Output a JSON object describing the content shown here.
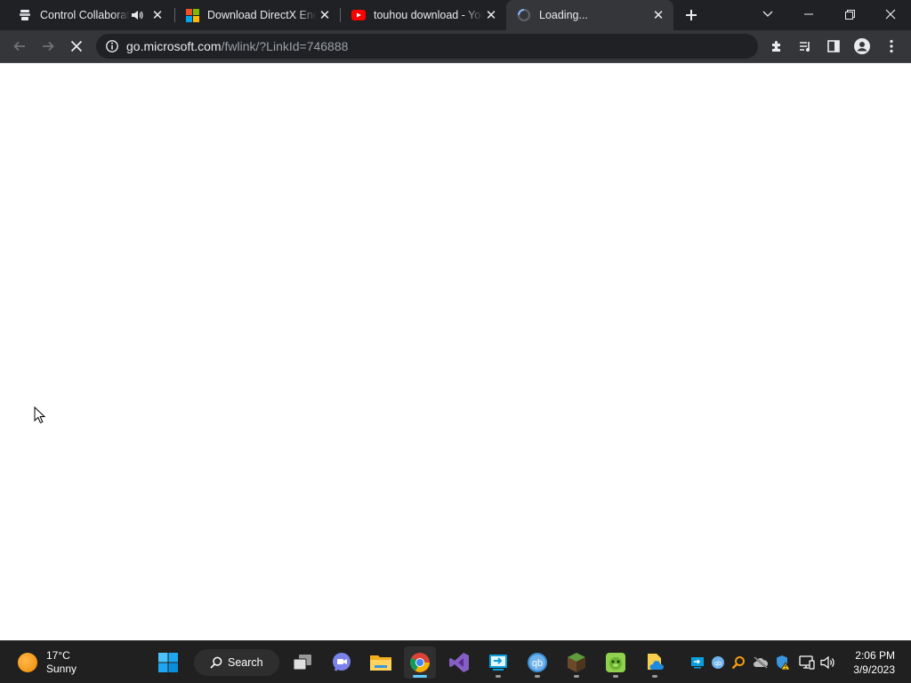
{
  "browser": {
    "tabs": [
      {
        "title": "Control Collaboration",
        "favicon": "parsec-icon",
        "audio": true
      },
      {
        "title": "Download DirectX End-User Runtime",
        "favicon": "microsoft-icon"
      },
      {
        "title": "touhou download - YouTube",
        "favicon": "youtube-icon"
      },
      {
        "title": "Loading...",
        "favicon": "loading-spinner-icon",
        "active": true
      }
    ],
    "new_tab_label": "+",
    "omnibox": {
      "host": "go.microsoft.com",
      "path": "/fwlink/?LinkId=746888"
    }
  },
  "taskbar": {
    "weather": {
      "temp": "17°C",
      "condition": "Sunny"
    },
    "search_label": "Search",
    "apps": [
      "start-icon",
      "search-icon",
      "task-view-icon",
      "chat-icon",
      "file-explorer-icon",
      "chrome-icon",
      "visual-studio-icon",
      "remote-app-icon",
      "qbittorrent-icon",
      "minecraft-icon",
      "game-icon",
      "file-app-icon"
    ],
    "clock": {
      "time": "2:06 PM",
      "date": "3/9/2023"
    }
  },
  "colors": {
    "tabstrip": "#202124",
    "toolbar": "#35363a",
    "taskbar": "#202020",
    "accent": "#60cdff"
  }
}
